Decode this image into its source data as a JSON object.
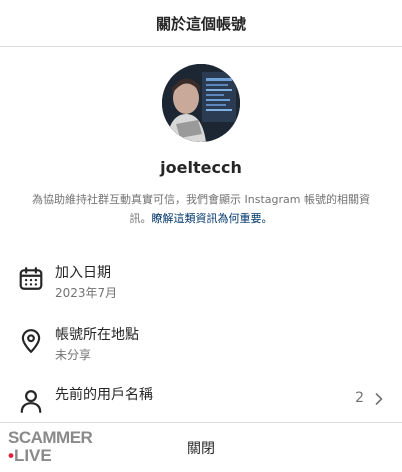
{
  "header": {
    "title": "關於這個帳號"
  },
  "profile": {
    "username": "joeltecch",
    "desc_main": "為協助維持社群互動真實可信，我們會顯示 Instagram 帳號的相關資訊。",
    "desc_link": "瞭解這類資訊為何重要。"
  },
  "rows": [
    {
      "title": "加入日期",
      "sub": "2023年7月",
      "icon": "calendar-icon"
    },
    {
      "title": "帳號所在地點",
      "sub": "未分享",
      "icon": "location-pin-icon"
    },
    {
      "title": "先前的用戶名稱",
      "count": "2",
      "icon": "person-icon"
    }
  ],
  "footer": {
    "close_label": "關閉"
  },
  "watermark": {
    "line1": "SCAMMER",
    "line2_dot": "•",
    "line2": "LIVE"
  },
  "colors": {
    "primary_text": "#262626",
    "secondary_text": "#737373",
    "link": "#00376b",
    "divider": "#dbdbdb",
    "watermark_accent": "#e0213a"
  }
}
